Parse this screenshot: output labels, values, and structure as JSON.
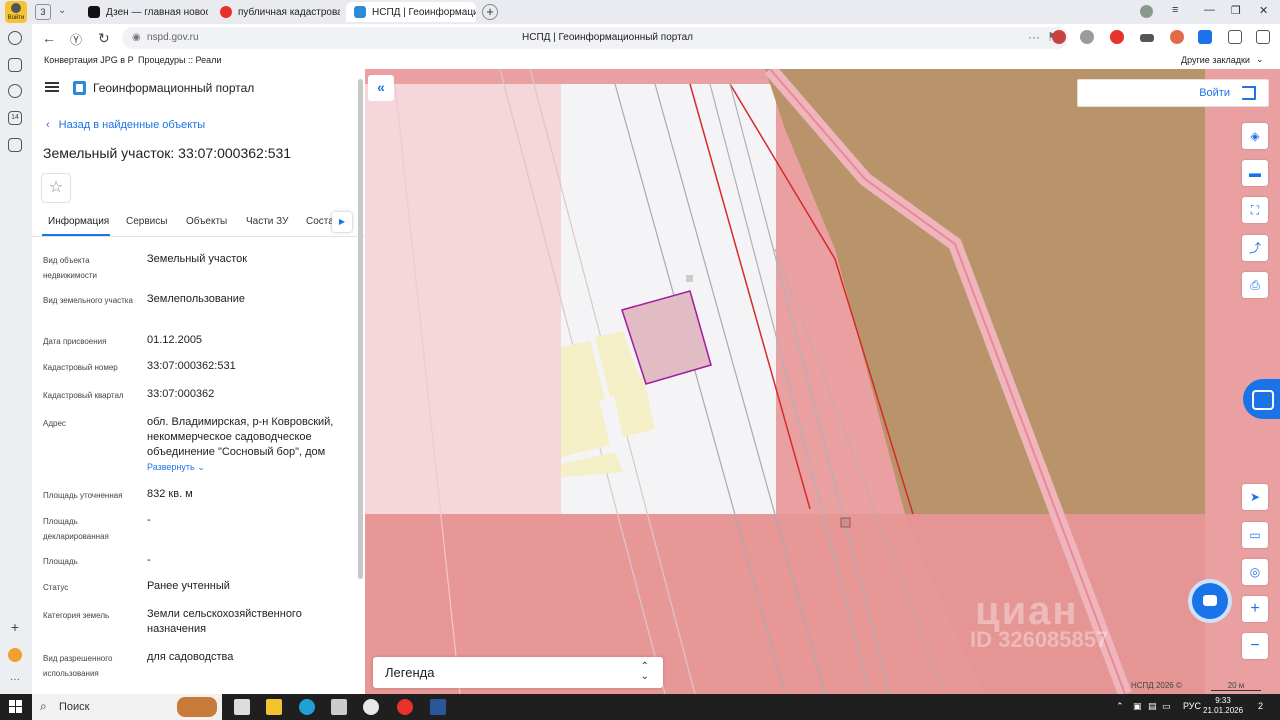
{
  "browser": {
    "tab_count": "3",
    "login_label": "Войти",
    "tabs": [
      {
        "label": "Дзен — главная новостн"
      },
      {
        "label": "публичная кадастровая"
      },
      {
        "label": "НСПД | Геоинформаци"
      }
    ],
    "url": "nspd.gov.ru",
    "page_title": "НСПД | Геоинформационный портал",
    "bookmarks": [
      "Конвертация JPG в Р",
      "Процедуры :: Реали"
    ],
    "other_bookmarks": "Другие закладки",
    "rail_badge": "14"
  },
  "panel": {
    "portal_name": "Геоинформационный портал",
    "back_link": "Назад в найденные объекты",
    "title": "Земельный участок: 33:07:000362:531",
    "tabs": [
      "Информация",
      "Сервисы",
      "Объекты",
      "Части ЗУ",
      "Соста"
    ],
    "properties": [
      {
        "label": "Вид объекта недвижимости",
        "value": "Земельный участок"
      },
      {
        "label": "Вид земельного участка",
        "value": "Землепользование"
      },
      {
        "label": "Дата присвоения",
        "value": "01.12.2005"
      },
      {
        "label": "Кадастровый номер",
        "value": "33:07:000362:531"
      },
      {
        "label": "Кадастровый квартал",
        "value": "33:07:000362"
      },
      {
        "label": "Адрес",
        "value": "обл. Владимирская, р-н Ковровский, некоммерческое садоводческое объединение \"Сосновый бор\", дом"
      },
      {
        "label": "Площадь уточненная",
        "value": "832 кв. м"
      },
      {
        "label": "Площадь декларированная",
        "value": "-"
      },
      {
        "label": "Площадь",
        "value": "-"
      },
      {
        "label": "Статус",
        "value": "Ранее учтенный"
      },
      {
        "label": "Категория земель",
        "value": "Земли сельскохозяйственного назначения"
      },
      {
        "label": "Вид разрешенного использования",
        "value": "для садоводства"
      }
    ],
    "expand_label": "Развернуть"
  },
  "map": {
    "login_label": "Войти",
    "legend_label": "Легенда",
    "copyright": "НСПД 2026 ©",
    "scale_label": "20 м",
    "watermark_logo": "циан",
    "watermark_id": "ID 326085857",
    "colors": {
      "zone_pink": "#eaa0a0",
      "zone_light": "#f5d6da",
      "zone_brown": "#b9946a",
      "parcel_fill": "#e2bcc4",
      "parcel_stroke": "#a01aa0",
      "boundary_red": "#d62a2a",
      "accent": "#1a73e8"
    }
  },
  "taskbar": {
    "search_label": "Поиск",
    "lang": "РУС",
    "time": "9:33",
    "date": "21.01.2026",
    "notifications": "2"
  }
}
